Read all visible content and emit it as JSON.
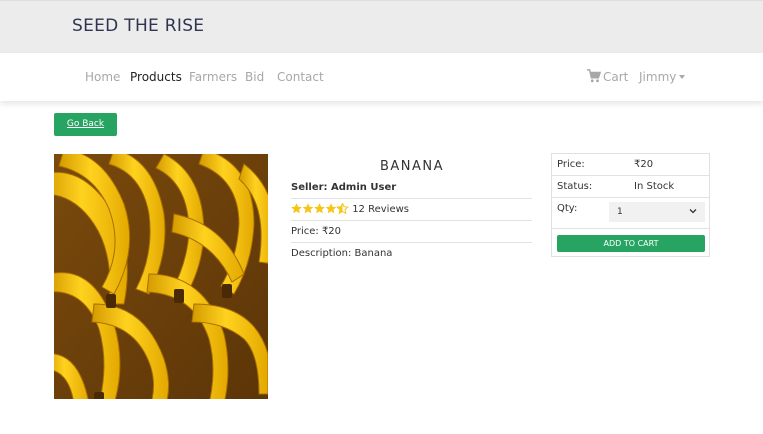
{
  "header": {
    "brand": "SEED THE RISE"
  },
  "nav": {
    "links": [
      "Home",
      "Products",
      "Farmers",
      "Bid",
      "Contact"
    ],
    "active": "Products",
    "cart_label": "Cart",
    "user_label": "Jimmy"
  },
  "actions": {
    "go_back": "Go Back"
  },
  "product": {
    "name": "BANANA",
    "seller": "Seller: Admin User",
    "rating": 4.5,
    "reviews": "12 Reviews",
    "price_line": "Price: ₹20",
    "description": "Description: Banana",
    "image": "banana-bunch"
  },
  "card": {
    "price_label": "Price:",
    "price_value": "₹20",
    "status_label": "Status:",
    "status_value": "In Stock",
    "qty_label": "Qty:",
    "qty_value": "1",
    "add_to_cart": "ADD TO CART"
  },
  "colors": {
    "accent_green": "#28a462",
    "star": "#f5c518",
    "brand_text": "#2f3450"
  }
}
